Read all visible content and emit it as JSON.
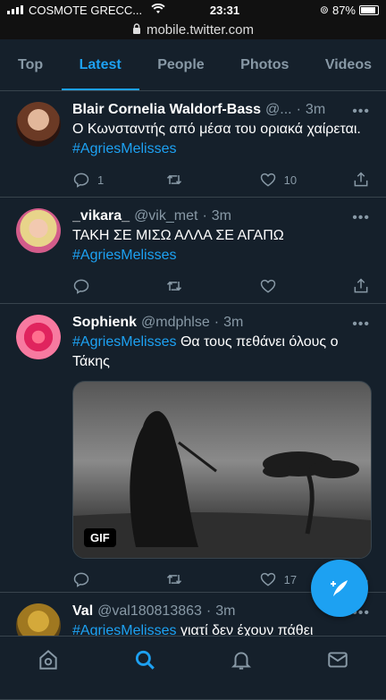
{
  "status_bar": {
    "carrier": "COSMOTE GRECC...",
    "time": "23:31",
    "battery": "87%",
    "battery_level": 0.87
  },
  "url_bar": {
    "url": "mobile.twitter.com"
  },
  "tabs": [
    {
      "label": "Top"
    },
    {
      "label": "Latest",
      "active": true
    },
    {
      "label": "People"
    },
    {
      "label": "Photos"
    },
    {
      "label": "Videos"
    }
  ],
  "tweets": [
    {
      "name": "Blair Cornelia Waldorf-Bass",
      "handle": "@...",
      "time": "3m",
      "text": "Ο Κωνσταντής από μέσα του οριακά χαίρεται.",
      "hashtag": "#AgriesMelisses",
      "replies": "1",
      "retweets": "",
      "likes": "10"
    },
    {
      "name": "_vikara_",
      "handle": "@vik_met",
      "time": "3m",
      "text": "ΤΑΚΗ ΣΕ ΜΙΣΩ ΑΛΛΑ ΣΕ ΑΓΑΠΩ",
      "hashtag": "#AgriesMelisses",
      "replies": "",
      "retweets": "",
      "likes": ""
    },
    {
      "name": "Sophienk",
      "handle": "@mdphlse",
      "time": "3m",
      "hashtag": "#AgriesMelisses",
      "text": "Θα τους πεθάνει όλους ο Τάκης",
      "media_badge": "GIF",
      "replies": "",
      "retweets": "",
      "likes": "17"
    },
    {
      "name": "Val",
      "handle": "@val180813863",
      "time": "3m",
      "hashtag": "#AgriesMelisses",
      "text": "γιατί δεν έχουν πάθει"
    }
  ],
  "colors": {
    "background": "#15202b",
    "accent": "#1da1f2",
    "muted": "#8899a6",
    "divider": "#38444d"
  },
  "bottom_nav": [
    "home-icon",
    "search-icon",
    "notifications-icon",
    "messages-icon"
  ]
}
